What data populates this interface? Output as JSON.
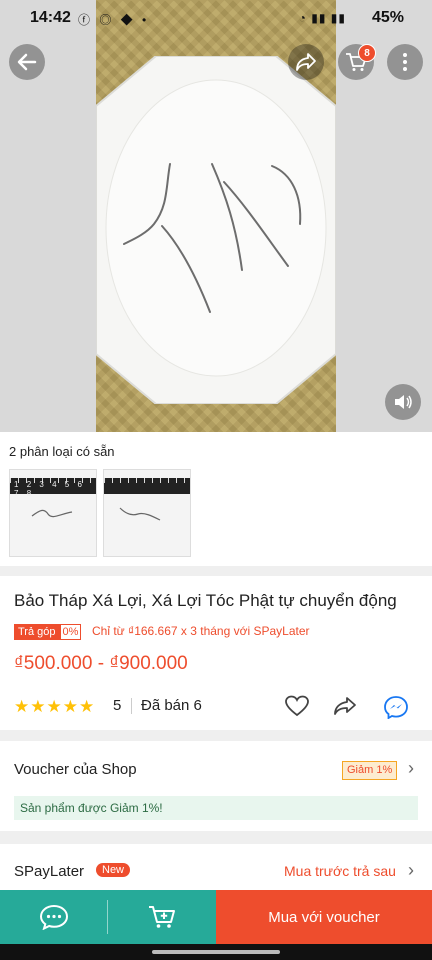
{
  "status_bar": {
    "time": "14:42",
    "battery": "45%"
  },
  "header": {
    "cart_count": "8"
  },
  "variations": {
    "label": "2 phân loại có sẵn",
    "ruler_numbers": [
      "1",
      "2",
      "3",
      "4",
      "5",
      "6",
      "7",
      "8"
    ]
  },
  "product": {
    "title": "Bảo Tháp Xá Lợi, Xá Lợi Tóc Phật tự chuyển động",
    "tra_gop_label": "Trả góp",
    "tra_gop_rate": "0%",
    "installment": "Chỉ từ ₫166.667 x 3 tháng với SPayLater",
    "price": "₫500.000 - ₫900.000",
    "stars": "★★★★★",
    "rating": "5",
    "sold": "Đã bán 6"
  },
  "voucher": {
    "label": "Voucher của Shop",
    "tag": "Giảm 1%",
    "note": "Sản phẩm được Giảm 1%!"
  },
  "spaylater": {
    "label": "SPayLater",
    "badge": "New",
    "cta": "Mua trước trả sau"
  },
  "bottom_bar": {
    "buy_label": "Mua với voucher"
  },
  "colors": {
    "accent": "#ee4d2d",
    "teal": "#26aa99",
    "star": "#ffc107"
  }
}
